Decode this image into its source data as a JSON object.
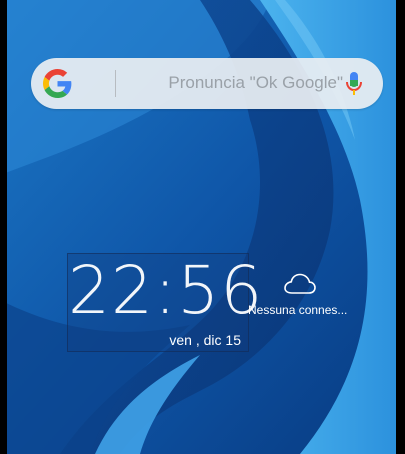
{
  "search": {
    "placeholder": "Pronuncia \"Ok Google\"",
    "logo_icon": "google-g-icon",
    "mic_icon": "microphone-icon"
  },
  "clock": {
    "time": "22:56",
    "date": "ven , dic 15"
  },
  "weather": {
    "icon": "cloud-icon",
    "status": "Nessuna connes..."
  },
  "colors": {
    "google_blue": "#4285F4",
    "google_red": "#EA4335",
    "google_yellow": "#FBBC05",
    "google_green": "#34A853"
  }
}
